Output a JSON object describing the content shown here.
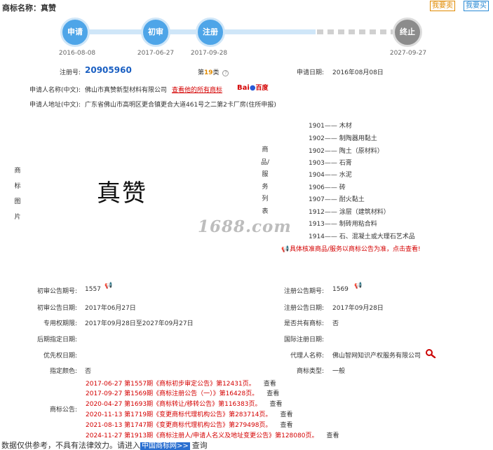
{
  "header": {
    "title": "商标名称：真赞",
    "buy_btn": "我要卖",
    "sell_btn": "我要买"
  },
  "progress": {
    "nodes": [
      "申请",
      "初审",
      "注册",
      "终止"
    ],
    "dates": [
      "2016-08-08",
      "2017-06-27",
      "2017-09-28",
      "2027-09-27"
    ]
  },
  "info": {
    "reg_no_label": "注册号:",
    "reg_no": "20905960",
    "class_prefix": "第",
    "class_num": "19",
    "class_suffix": "类",
    "apply_date_label": "申请日期:",
    "apply_date": "2016年08月08日",
    "applicant_label": "申请人名称(中文):",
    "applicant": "佛山市真赞新型材料有限公司",
    "view_all_link": "查看他的所有商标",
    "baidu_text": "百度",
    "address_label": "申请人地址(中文):",
    "address": "广东省佛山市高明区更合镇更合大道461号之二第2卡厂房(住所申报)"
  },
  "image_section": {
    "label": "商标图片",
    "mark_text": "真赞",
    "watermark": "1688.com"
  },
  "goods": {
    "label": "商品/服务列表",
    "items": [
      {
        "code": "1901",
        "name": "木材"
      },
      {
        "code": "1902",
        "name": "制陶器用黏土"
      },
      {
        "code": "1902",
        "name": "陶土（原材料）"
      },
      {
        "code": "1903",
        "name": "石膏"
      },
      {
        "code": "1904",
        "name": "水泥"
      },
      {
        "code": "1906",
        "name": "砖"
      },
      {
        "code": "1907",
        "name": "耐火黏土"
      },
      {
        "code": "1912",
        "name": "涂层（建筑材料）"
      },
      {
        "code": "1913",
        "name": "制砖用粘合料"
      },
      {
        "code": "1914",
        "name": "石、混凝土或大理石艺术品"
      }
    ],
    "notice": "具体核准商品/服务以商标公告为准，点击查看!"
  },
  "details": {
    "prelim_no_label": "初审公告期号:",
    "prelim_no": "1557",
    "reg_notice_no_label": "注册公告期号:",
    "reg_notice_no": "1569",
    "prelim_date_label": "初审公告日期:",
    "prelim_date": "2017年06月27日",
    "reg_notice_date_label": "注册公告日期:",
    "reg_notice_date": "2017年09月28日",
    "exclusive_label": "专用权期限:",
    "exclusive": "2017年09月28日至2027年09月27日",
    "shared_label": "是否共有商标:",
    "shared": "否",
    "later_date_label": "后期指定日期:",
    "intl_date_label": "国际注册日期:",
    "priority_label": "优先权日期:",
    "agent_label": "代理人名称:",
    "agent": "佛山智网知识产权服务有限公司",
    "color_label": "指定颜色:",
    "color": "否",
    "type_label": "商标类型:",
    "type": "一般",
    "ann_label": "商标公告:"
  },
  "announcements": [
    {
      "text": "2017-06-27 第1557期《商标初步审定公告》第12431页。",
      "action": "查看"
    },
    {
      "text": "2017-09-27 第1569期《商标注册公告（一）》第16428页。",
      "action": "查看"
    },
    {
      "text": "2020-04-27 第1693期《商标转让/移转公告》第116383页。",
      "action": "查看"
    },
    {
      "text": "2020-11-13 第1719期《变更商标代理机构公告》第283714页。",
      "action": "查看"
    },
    {
      "text": "2021-08-13 第1747期《变更商标代理机构公告》第279498页。",
      "action": "查看"
    },
    {
      "text": "2024-11-27 第1913期《商标注册人/申请人名义及地址变更公告》第128080页。",
      "action": "查看"
    }
  ],
  "footer": {
    "prefix": "数据仅供参考，不具有法律效力。请进入",
    "link": "中国商标网>>",
    "suffix": "查询"
  },
  "colors": {
    "accent": "#4ea5e8",
    "link_red": "#d40000",
    "reg_no": "#1a5fc2"
  }
}
